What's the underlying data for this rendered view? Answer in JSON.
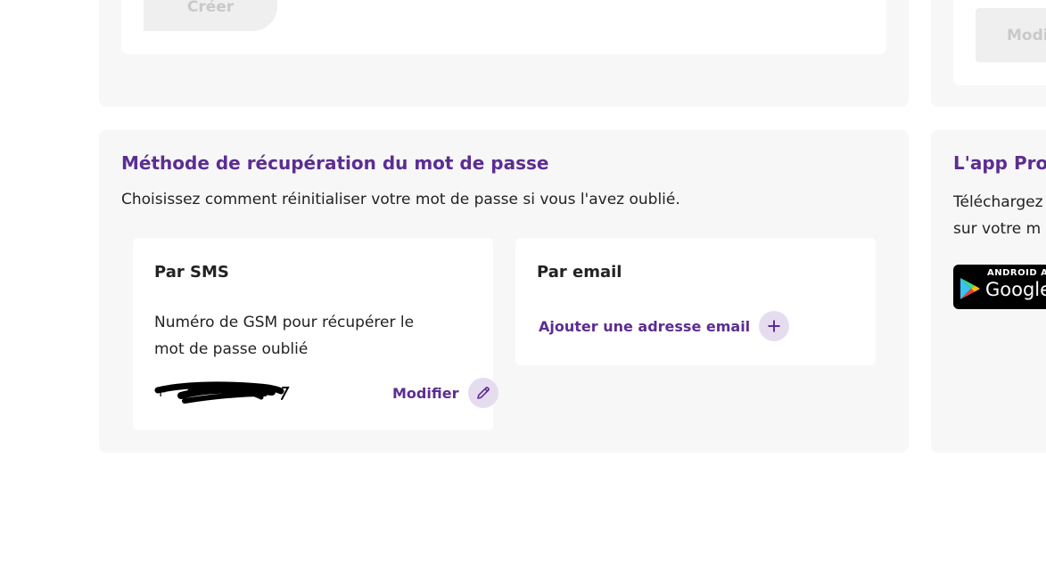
{
  "top_section": {
    "create_button_label": "Créer",
    "modify_button_label": "Modi"
  },
  "recovery": {
    "title": "Méthode de récupération du mot de passe",
    "description": "Choisissez comment réinitialiser votre mot de passe si vous l'avez oublié.",
    "sms": {
      "title": "Par SMS",
      "description": "Numéro de GSM pour récupérer le mot de passe oublié",
      "phone_value": "+",
      "modify_label": "Modifier",
      "modify_icon": "pencil-icon"
    },
    "email": {
      "title": "Par email",
      "add_label": "Ajouter une adresse email",
      "add_icon": "plus-icon"
    }
  },
  "app": {
    "title": "L'app Prox",
    "description_line1": "Téléchargez",
    "description_line2": "sur votre m",
    "store_badge_small": "ANDROID A",
    "store_badge_big": "Google"
  },
  "colors": {
    "accent": "#5c2d91",
    "icon_circle_bg": "#e6dcf0",
    "panel_bg": "#f7f7f7",
    "card_bg": "#ffffff",
    "disabled_button_bg": "#efefef"
  }
}
